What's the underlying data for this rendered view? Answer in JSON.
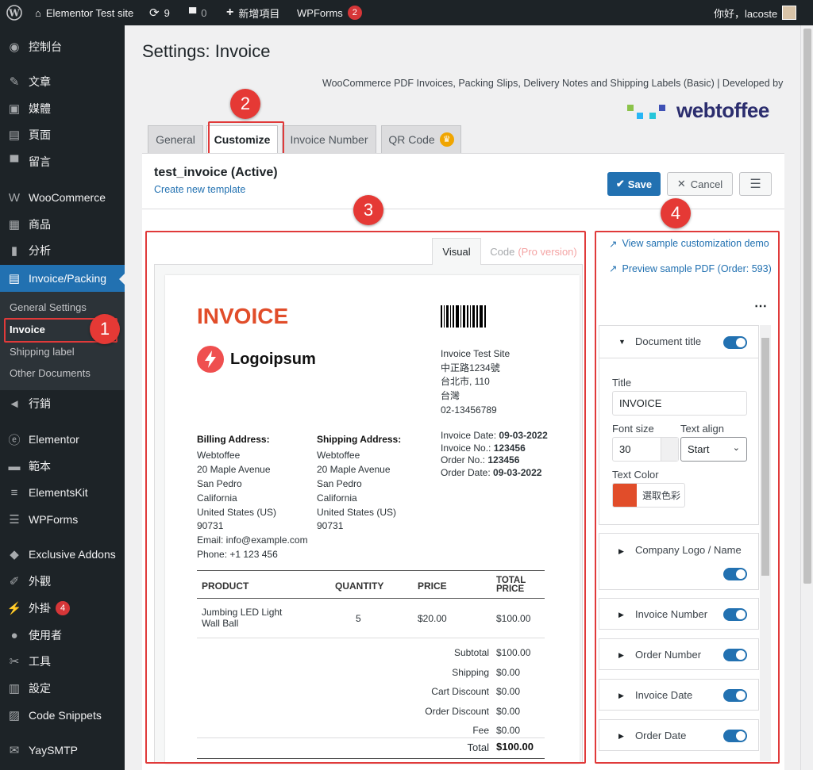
{
  "adminbar": {
    "site_name": "Elementor Test site",
    "updates_count": "9",
    "comments_count": "0",
    "new_item": "新增項目",
    "wpforms": "WPForms",
    "wpforms_badge": "2",
    "greeting": "你好，lacoste"
  },
  "sidebar": {
    "items": [
      {
        "label": "控制台",
        "icon": "dashboard-icon"
      },
      {
        "label": "文章",
        "icon": "pin-icon"
      },
      {
        "label": "媒體",
        "icon": "media-icon"
      },
      {
        "label": "頁面",
        "icon": "page-icon"
      },
      {
        "label": "留言",
        "icon": "comment-icon"
      },
      {
        "label": "WooCommerce",
        "icon": "woo-icon"
      },
      {
        "label": "商品",
        "icon": "product-icon"
      },
      {
        "label": "分析",
        "icon": "chart-icon"
      },
      {
        "label": "Invoice/Packing",
        "icon": "document-icon"
      },
      {
        "label": "行銷",
        "icon": "megaphone-icon"
      },
      {
        "label": "Elementor",
        "icon": "elementor-icon"
      },
      {
        "label": "範本",
        "icon": "folder-icon"
      },
      {
        "label": "ElementsKit",
        "icon": "ek-icon"
      },
      {
        "label": "WPForms",
        "icon": "form-icon"
      },
      {
        "label": "Exclusive Addons",
        "icon": "addons-icon"
      },
      {
        "label": "外觀",
        "icon": "brush-icon"
      },
      {
        "label": "外掛",
        "icon": "plugin-icon",
        "badge": "4"
      },
      {
        "label": "使用者",
        "icon": "user-icon"
      },
      {
        "label": "工具",
        "icon": "wrench-icon"
      },
      {
        "label": "設定",
        "icon": "settings-icon"
      },
      {
        "label": "Code Snippets",
        "icon": "code-icon"
      },
      {
        "label": "YaySMTP",
        "icon": "mail-icon"
      }
    ],
    "submenu": [
      "General Settings",
      "Invoice",
      "Shipping label",
      "Other Documents"
    ]
  },
  "page": {
    "title": "Settings: Invoice",
    "plugin_line": "WooCommerce PDF Invoices, Packing Slips, Delivery Notes and Shipping Labels (Basic) | Developed by",
    "brand": "webtoffee",
    "tabs": [
      "General",
      "Customize",
      "Invoice Number",
      "QR Code"
    ]
  },
  "template": {
    "name": "test_invoice (Active)",
    "create_link": "Create new template",
    "save": "Save",
    "cancel": "Cancel"
  },
  "editor": {
    "tab_visual": "Visual",
    "tab_code": "Code",
    "tab_code_note": "(Pro version)"
  },
  "invoice": {
    "title": "INVOICE",
    "logo_text": "Logoipsum",
    "from": [
      "Invoice Test Site",
      "中正路1234號",
      "台北市, 110",
      "台灣",
      "02-13456789"
    ],
    "billing_heading": "Billing Address:",
    "billing": [
      "Webtoffee",
      "20 Maple Avenue",
      "San Pedro",
      "California",
      "United States (US)",
      "90731",
      "Email: info@example.com",
      "Phone: +1 123 456"
    ],
    "shipping_heading": "Shipping Address:",
    "shipping": [
      "Webtoffee",
      "20 Maple Avenue",
      "San Pedro",
      "California",
      "United States (US)",
      "90731"
    ],
    "meta": [
      {
        "label": "Invoice Date:",
        "value": "09-03-2022"
      },
      {
        "label": "Invoice No.:",
        "value": "123456"
      },
      {
        "label": "Order No.:",
        "value": "123456"
      },
      {
        "label": "Order Date:",
        "value": "09-03-2022"
      }
    ],
    "columns": [
      "PRODUCT",
      "QUANTITY",
      "PRICE",
      "TOTAL PRICE"
    ],
    "product": {
      "name": "Jumbing LED Light Wall Ball",
      "qty": "5",
      "price": "$20.00",
      "total": "$100.00"
    },
    "totals": [
      {
        "label": "Subtotal",
        "value": "$100.00"
      },
      {
        "label": "Shipping",
        "value": "$0.00"
      },
      {
        "label": "Cart Discount",
        "value": "$0.00"
      },
      {
        "label": "Order Discount",
        "value": "$0.00"
      },
      {
        "label": "Fee",
        "value": "$0.00"
      }
    ],
    "grand_label": "Total",
    "grand_value": "$100.00"
  },
  "customizer": {
    "link_demo": "View sample customization demo",
    "link_preview": "Preview sample PDF (Order: 593)",
    "document_title": {
      "heading": "Document title",
      "title_label": "Title",
      "title_value": "INVOICE",
      "font_size_label": "Font size",
      "font_size_value": "30",
      "align_label": "Text align",
      "align_value": "Start",
      "color_label": "Text Color",
      "color_button": "選取色彩",
      "color_value": "#e14d2a"
    },
    "sections": [
      "Company Logo / Name",
      "Invoice Number",
      "Order Number",
      "Invoice Date",
      "Order Date"
    ]
  },
  "annotations": [
    "1",
    "2",
    "3",
    "4"
  ],
  "colors": {
    "accent": "#2271b1",
    "invoice_red": "#e14d2a",
    "annotation": "#e53935"
  }
}
